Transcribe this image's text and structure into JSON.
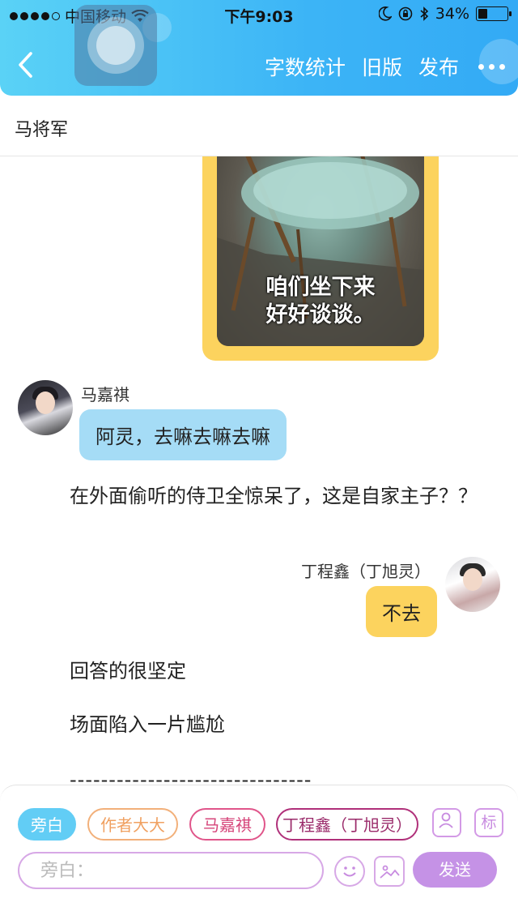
{
  "status_bar": {
    "carrier": "中国移动",
    "time": "下午9:03",
    "battery": "34%",
    "battery_level": 0.34,
    "signal_bars_filled": 4,
    "signal_bars_total": 5
  },
  "header": {
    "back_icon": "chevron-left-icon",
    "actions": {
      "word_count": "字数统计",
      "old_version": "旧版",
      "publish": "发布"
    },
    "more_icon": "more-dots-icon",
    "accent_color": "#3cb4f6"
  },
  "title": "马将军",
  "content": {
    "meme_caption_line1": "咱们坐下来",
    "meme_caption_line2": "好好谈谈。",
    "message1": {
      "sender": "马嘉祺",
      "text": "阿灵，去嘛去嘛去嘛"
    },
    "narration1": "在外面偷听的侍卫全惊呆了，这是自家主子？？",
    "message2": {
      "sender": "丁程鑫（丁旭灵）",
      "text": "不去"
    },
    "narration2": "回答的很坚定",
    "narration3": "场面陷入一片尴尬",
    "divider": "-------------------------------"
  },
  "bottom": {
    "chips": {
      "narration": "旁白",
      "author": "作者大大",
      "ma": "马嘉祺",
      "ding": "丁程鑫（丁旭灵）"
    },
    "tag_label": "标",
    "input_placeholder": "旁白：",
    "send": "发送",
    "accent_color": "#c592e6"
  }
}
